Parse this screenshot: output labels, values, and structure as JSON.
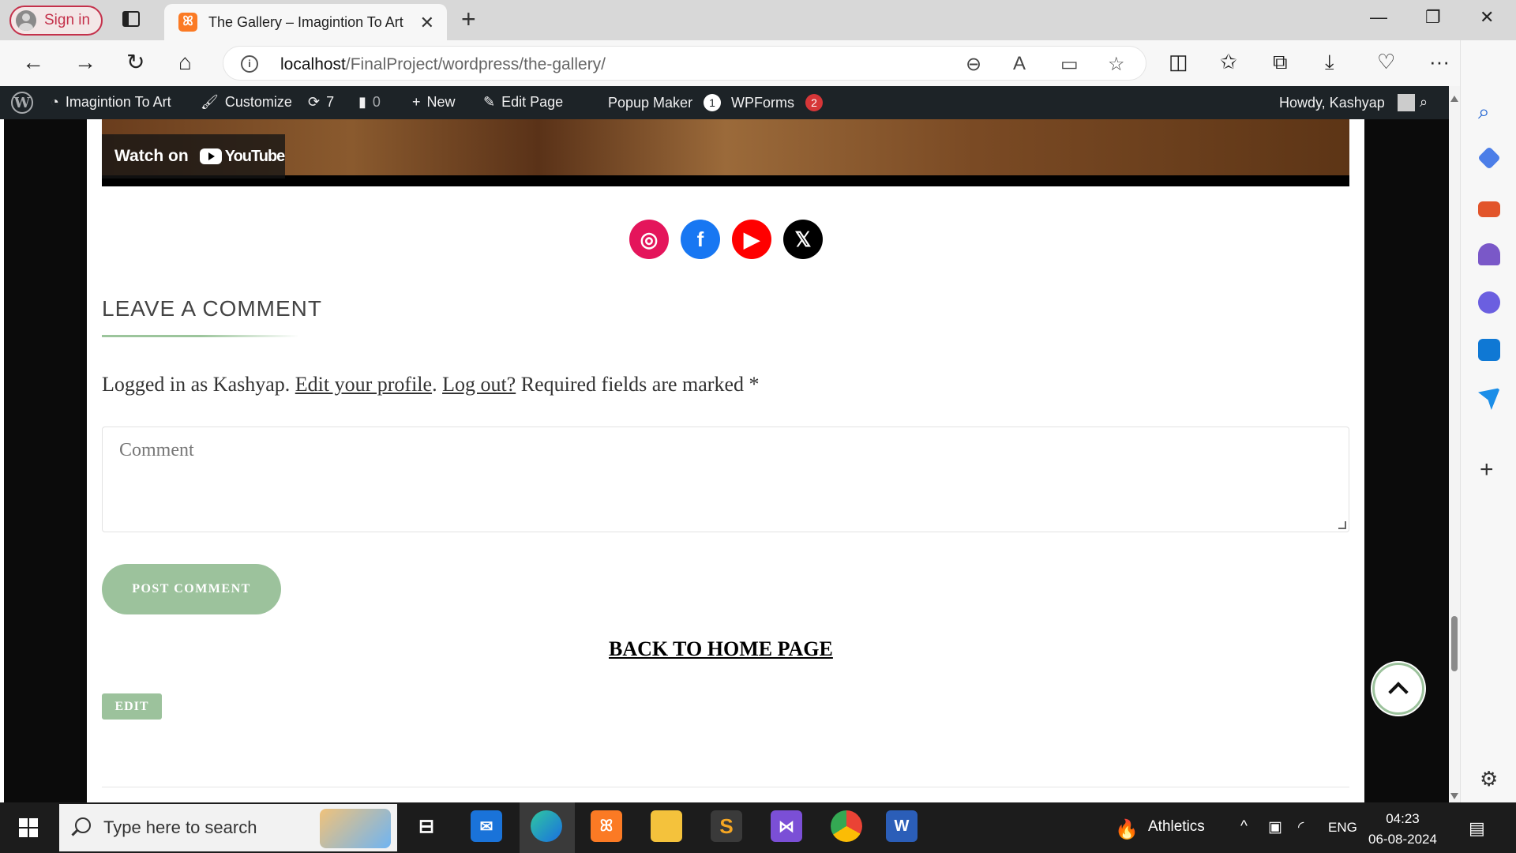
{
  "browser": {
    "signin_label": "Sign in",
    "tab_title": "The Gallery – Imagintion To Art",
    "tab_favicon": "xampp-icon",
    "url_host": "localhost",
    "url_path": "/FinalProject/wordpress/the-gallery/"
  },
  "wpbar": {
    "site_name": "Imagintion To Art",
    "customize": "Customize",
    "updates_count": "7",
    "comments_count": "0",
    "new_label": "New",
    "edit_page": "Edit Page",
    "popup_maker": "Popup Maker",
    "popup_maker_badge": "1",
    "wpforms": "WPForms",
    "wpforms_badge": "2",
    "howdy": "Howdy, Kashyap"
  },
  "video": {
    "watch_on": "Watch on",
    "youtube": "YouTube"
  },
  "social": [
    {
      "name": "instagram-icon",
      "color": "#e4155b"
    },
    {
      "name": "facebook-icon",
      "color": "#1877f2"
    },
    {
      "name": "youtube-icon",
      "color": "#ff0000"
    },
    {
      "name": "x-icon",
      "color": "#000000"
    }
  ],
  "comment_section": {
    "title": "LEAVE A COMMENT",
    "logged_in_prefix": "Logged in as Kashyap. ",
    "edit_profile": "Edit your profile",
    "dot": ". ",
    "log_out": "Log out?",
    "required_suffix": " Required fields are marked *",
    "comment_placeholder": "Comment",
    "post_button": "POST COMMENT"
  },
  "back_home": "BACK TO HOME PAGE",
  "edit_button": "EDIT",
  "taskbar": {
    "search_placeholder": "Type here to search",
    "weather": "Athletics",
    "language": "ENG",
    "time": "04:23",
    "date": "06-08-2024"
  },
  "colors": {
    "accent_green": "#9cc29c",
    "wpbar_bg": "#1d2327"
  }
}
